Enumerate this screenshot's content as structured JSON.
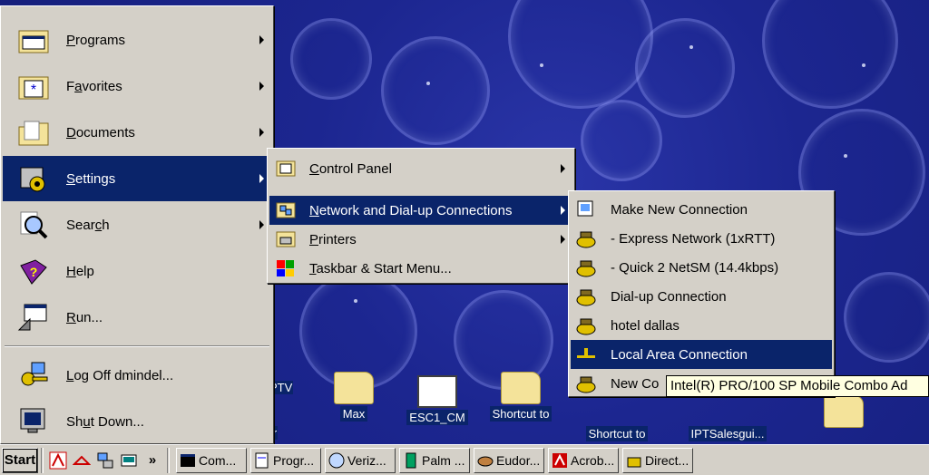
{
  "start_menu": {
    "items": [
      {
        "label": "Programs",
        "accel": "P",
        "rest": "rograms",
        "arrow": true
      },
      {
        "label": "Favorites",
        "accel": "",
        "pre": "F",
        "under": "a",
        "rest": "vorites",
        "arrow": true
      },
      {
        "label": "Documents",
        "pre": "",
        "under": "D",
        "rest": "ocuments",
        "arrow": true
      },
      {
        "label": "Settings",
        "pre": "",
        "under": "S",
        "rest": "ettings",
        "arrow": true
      },
      {
        "label": "Search",
        "pre": "Sear",
        "under": "c",
        "rest": "h",
        "arrow": true
      },
      {
        "label": "Help",
        "pre": "",
        "under": "H",
        "rest": "elp",
        "arrow": false
      },
      {
        "label": "Run...",
        "pre": "",
        "under": "R",
        "rest": "un...",
        "arrow": false
      },
      {
        "label": "Log Off dmindel...",
        "pre": "",
        "under": "L",
        "rest": "og Off dmindel...",
        "arrow": false
      },
      {
        "label": "Shut Down...",
        "pre": "Sh",
        "under": "u",
        "rest": "t Down...",
        "arrow": false
      }
    ]
  },
  "settings_menu": {
    "control_panel": {
      "pre": "",
      "under": "C",
      "rest": "ontrol Panel"
    },
    "network": {
      "pre": "",
      "under": "N",
      "rest": "etwork and Dial-up Connections"
    },
    "printers": {
      "pre": "",
      "under": "P",
      "rest": "rinters"
    },
    "taskbar": {
      "pre": "",
      "under": "T",
      "rest": "askbar & Start Menu..."
    }
  },
  "network_menu": {
    "items": [
      "Make New Connection",
      "- Express Network (1xRTT)",
      "- Quick 2 NetSM (14.4kbps)",
      "Dial-up Connection",
      "hotel dallas",
      "Local Area Connection",
      "New Co"
    ]
  },
  "tooltip": "Intel(R) PRO/100 SP Mobile Combo Ad",
  "desktop_icons": {
    "ptv": "PTV",
    "max": "Max",
    "esc": "ESC1_CM",
    "shortcut1": "Shortcut to",
    "shortcut2": "Shortcut to",
    "ipt": "IPTSalesgui...",
    "r": "r"
  },
  "taskbar": {
    "start": "Start",
    "chevron": "»",
    "tasks": [
      "Com...",
      "Progr...",
      "Veriz...",
      "Palm ...",
      "Eudor...",
      "Acrob...",
      "Direct..."
    ]
  },
  "colors": {
    "highlight": "#0a246a",
    "face": "#d4d0c8",
    "desktop": "#1b2590"
  }
}
